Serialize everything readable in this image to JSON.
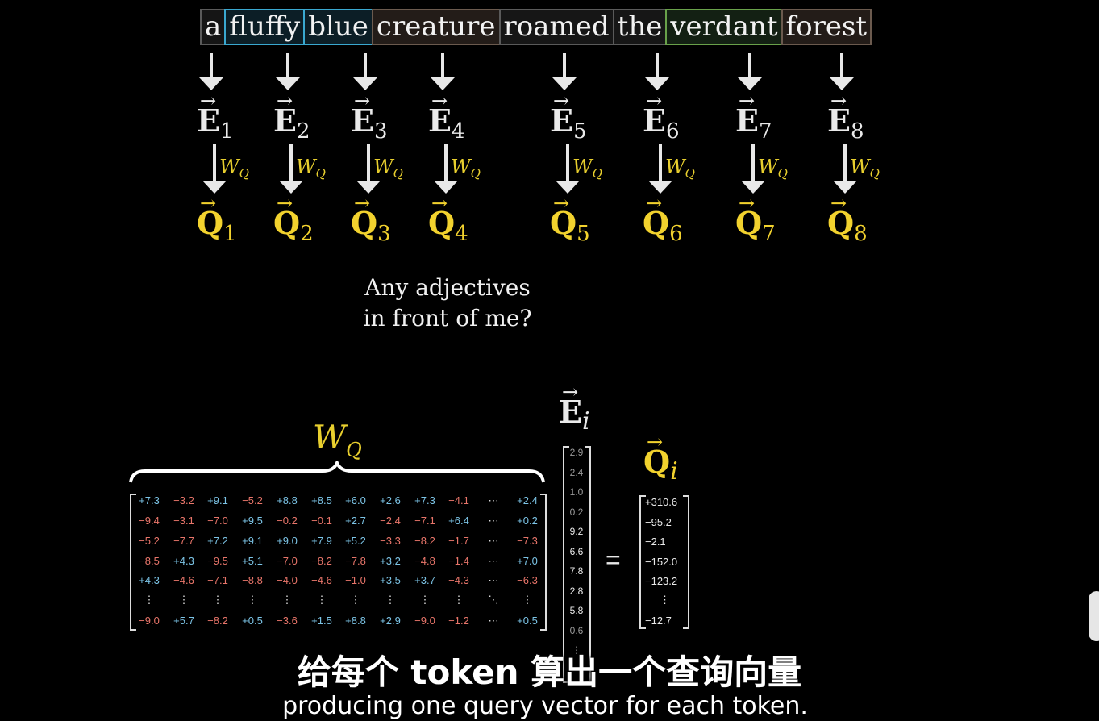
{
  "tokens": [
    {
      "text": "a",
      "style": "tok-a"
    },
    {
      "text": "fluffy",
      "style": "tok-blue"
    },
    {
      "text": "blue",
      "style": "tok-blue"
    },
    {
      "text": "creature",
      "style": "tok-brown"
    },
    {
      "text": "roamed",
      "style": "tok-gray"
    },
    {
      "text": "the",
      "style": "tok-gray"
    },
    {
      "text": "verdant",
      "style": "tok-green"
    },
    {
      "text": "forest",
      "style": "tok-brown"
    }
  ],
  "embedding_symbol": "E",
  "query_symbol": "Q",
  "weight_label": "W",
  "weight_subscript": "Q",
  "vector_indices": [
    "1",
    "2",
    "3",
    "4",
    "5",
    "6",
    "7",
    "8"
  ],
  "question_line1": "Any adjectives",
  "question_line2": "in front of me?",
  "generic_index": "i",
  "matrix_rows": [
    [
      "+7.3",
      "−3.2",
      "+9.1",
      "−5.2",
      "+8.8",
      "+8.5",
      "+6.0",
      "+2.6",
      "+7.3",
      "−4.1",
      "⋯",
      "+2.4"
    ],
    [
      "−9.4",
      "−3.1",
      "−7.0",
      "+9.5",
      "−0.2",
      "−0.1",
      "+2.7",
      "−2.4",
      "−7.1",
      "+6.4",
      "⋯",
      "+0.2"
    ],
    [
      "−5.2",
      "−7.7",
      "+7.2",
      "+9.1",
      "+9.0",
      "+7.9",
      "+5.2",
      "−3.3",
      "−8.2",
      "−1.7",
      "⋯",
      "−7.3"
    ],
    [
      "−8.5",
      "+4.3",
      "−9.5",
      "+5.1",
      "−7.0",
      "−8.2",
      "−7.8",
      "+3.2",
      "−4.8",
      "−1.4",
      "⋯",
      "+7.0"
    ],
    [
      "+4.3",
      "−4.6",
      "−7.1",
      "−8.8",
      "−4.0",
      "−4.6",
      "−1.0",
      "+3.5",
      "+3.7",
      "−4.3",
      "⋯",
      "−6.3"
    ],
    [
      "⋮",
      "⋮",
      "⋮",
      "⋮",
      "⋮",
      "⋮",
      "⋮",
      "⋮",
      "⋮",
      "⋮",
      "⋱",
      "⋮"
    ],
    [
      "−9.0",
      "+5.7",
      "−8.2",
      "+0.5",
      "−3.6",
      "+1.5",
      "+8.8",
      "+2.9",
      "−9.0",
      "−1.2",
      "⋯",
      "+0.5"
    ]
  ],
  "embedding_vector": [
    "2.9",
    "2.4",
    "1.0",
    "0.2",
    "9.2",
    "6.6",
    "7.8",
    "2.8",
    "5.8",
    "0.6",
    "⋮"
  ],
  "query_vector": [
    "+310.6",
    "−95.2",
    "−2.1",
    "−152.0",
    "−123.2",
    "⋮",
    "−12.7"
  ],
  "equals_sign": "=",
  "subtitle_zh": "给每个 token 算出一个查询向量",
  "subtitle_en": "producing one query vector for each token.",
  "colors": {
    "query": "#f2d22e",
    "positive": "#7cc4e6",
    "negative": "#e8756a",
    "blue_token": "#3aa8d0",
    "green_token": "#69a14a"
  }
}
